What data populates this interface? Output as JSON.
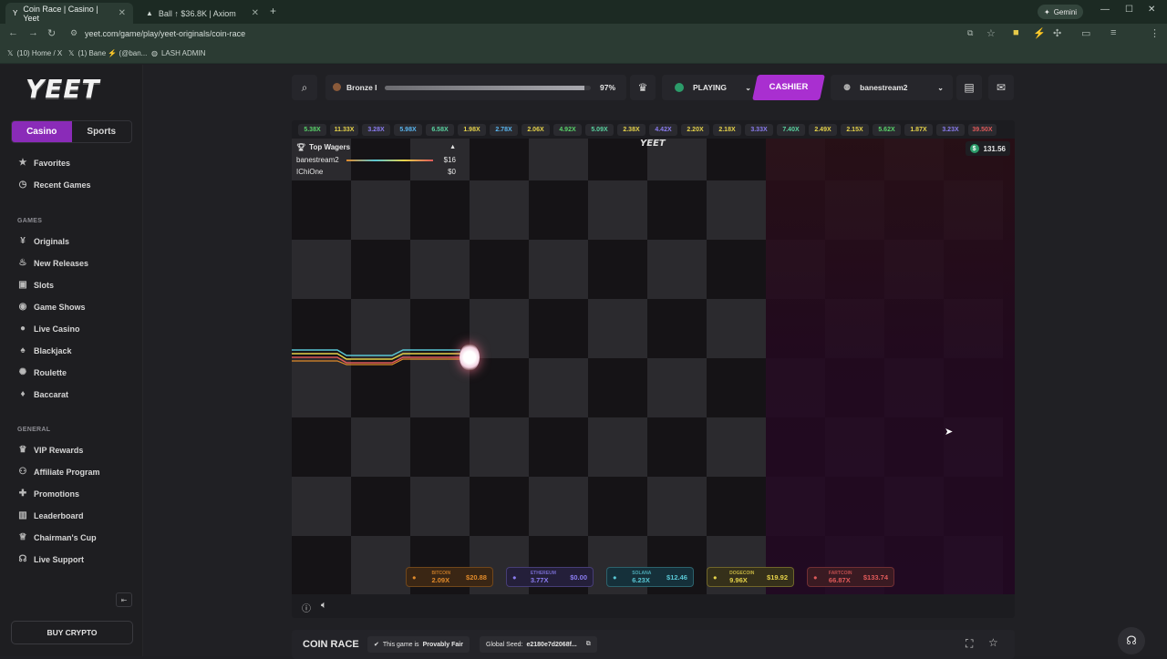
{
  "browser": {
    "tabs": [
      {
        "title": "Coin Race | Casino | Yeet",
        "active": true
      },
      {
        "title": "Ball ↑ $36.8K | Axiom",
        "active": false
      }
    ],
    "gemini_label": "Gemini",
    "url": "yeet.com/game/play/yeet-originals/coin-race",
    "bookmarks": [
      "(10) Home / X",
      "(1) Bane ⚡ (@ban...",
      "LASH ADMIN"
    ]
  },
  "sidebar": {
    "logo": "YEET",
    "tabs": [
      {
        "label": "Casino",
        "active": true
      },
      {
        "label": "Sports",
        "active": false
      }
    ],
    "top_items": [
      {
        "label": "Favorites",
        "icon": "star-icon"
      },
      {
        "label": "Recent Games",
        "icon": "history-icon"
      }
    ],
    "games_section": "GAMES",
    "games_items": [
      {
        "label": "Originals",
        "icon": "yeet-icon"
      },
      {
        "label": "New Releases",
        "icon": "flame-icon"
      },
      {
        "label": "Slots",
        "icon": "slots-icon"
      },
      {
        "label": "Game Shows",
        "icon": "gameshow-icon"
      },
      {
        "label": "Live Casino",
        "icon": "live-icon"
      },
      {
        "label": "Blackjack",
        "icon": "cards-icon"
      },
      {
        "label": "Roulette",
        "icon": "roulette-icon"
      },
      {
        "label": "Baccarat",
        "icon": "baccarat-icon"
      }
    ],
    "general_section": "GENERAL",
    "general_items": [
      {
        "label": "VIP Rewards",
        "icon": "crown-icon"
      },
      {
        "label": "Affiliate Program",
        "icon": "affiliate-icon"
      },
      {
        "label": "Promotions",
        "icon": "gift-icon"
      },
      {
        "label": "Leaderboard",
        "icon": "leaderboard-icon"
      },
      {
        "label": "Chairman's Cup",
        "icon": "trophy-icon"
      },
      {
        "label": "Live Support",
        "icon": "support-icon"
      }
    ],
    "buy_crypto": "BUY CRYPTO"
  },
  "header": {
    "rank": "Bronze I",
    "rank_progress_percent": 97,
    "rank_progress_label": "97%",
    "playing_label": "PLAYING",
    "cashier_label": "CASHIER",
    "username": "banestream2"
  },
  "game": {
    "multipliers": [
      {
        "v": "5.38X",
        "c": "#59d36a"
      },
      {
        "v": "11.33X",
        "c": "#e6d34a"
      },
      {
        "v": "3.28X",
        "c": "#8a7cf0"
      },
      {
        "v": "5.98X",
        "c": "#59b6f0"
      },
      {
        "v": "6.58X",
        "c": "#59d3a0"
      },
      {
        "v": "1.98X",
        "c": "#e6d34a"
      },
      {
        "v": "2.78X",
        "c": "#59b6f0"
      },
      {
        "v": "2.06X",
        "c": "#e6d34a"
      },
      {
        "v": "4.92X",
        "c": "#59d36a"
      },
      {
        "v": "5.09X",
        "c": "#59d3a0"
      },
      {
        "v": "2.38X",
        "c": "#e6d34a"
      },
      {
        "v": "4.42X",
        "c": "#8a7cf0"
      },
      {
        "v": "2.20X",
        "c": "#e6d34a"
      },
      {
        "v": "2.18X",
        "c": "#e6d34a"
      },
      {
        "v": "3.33X",
        "c": "#8a7cf0"
      },
      {
        "v": "7.40X",
        "c": "#59d3a0"
      },
      {
        "v": "2.49X",
        "c": "#e6d34a"
      },
      {
        "v": "2.15X",
        "c": "#e6d34a"
      },
      {
        "v": "5.62X",
        "c": "#59d36a"
      },
      {
        "v": "1.87X",
        "c": "#e6d34a"
      },
      {
        "v": "3.23X",
        "c": "#8a7cf0"
      },
      {
        "v": "39.50X",
        "c": "#e05a5a"
      }
    ],
    "top_wagers_title": "Top Wagers",
    "wagers": [
      {
        "name": "banestream2",
        "amount": "$16"
      },
      {
        "name": "IChiOne",
        "amount": "$0"
      }
    ],
    "logo": "YEET",
    "balance": "131.56",
    "runners": [
      {
        "coin": "BITCOIN",
        "mult": "2.09X",
        "amount": "$20.88",
        "color": "#e08a2a",
        "bg": "#3a2614"
      },
      {
        "coin": "ETHEREUM",
        "mult": "3.77X",
        "amount": "$0.00",
        "color": "#8a7cf0",
        "bg": "#241f3a"
      },
      {
        "coin": "SOLANA",
        "mult": "6.23X",
        "amount": "$12.46",
        "color": "#59c6d3",
        "bg": "#15303a"
      },
      {
        "coin": "DOGECOIN",
        "mult": "9.96X",
        "amount": "$19.92",
        "color": "#e6d34a",
        "bg": "#35301a"
      },
      {
        "coin": "FARTCOIN",
        "mult": "66.87X",
        "amount": "$133.74",
        "color": "#e05a5a",
        "bg": "#3a1a22"
      }
    ]
  },
  "footer": {
    "title": "COIN RACE",
    "provably_prefix": "This game is ",
    "provably_fair": "Provably Fair",
    "seed_label": "Global Seed:",
    "seed_value": "e2180e7d2068f..."
  }
}
